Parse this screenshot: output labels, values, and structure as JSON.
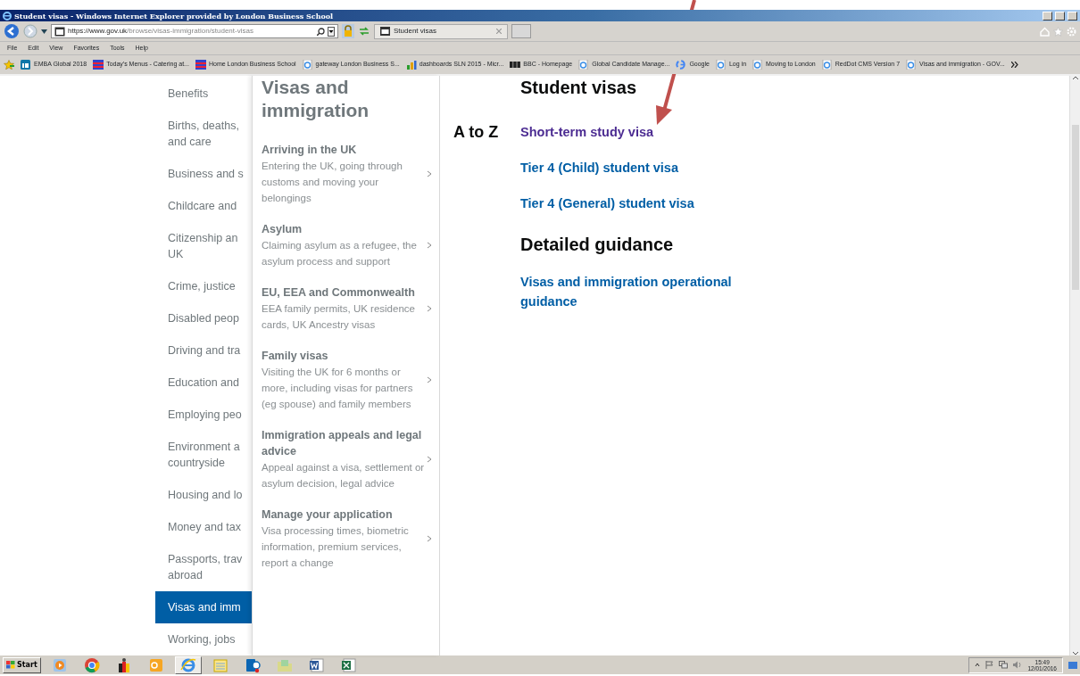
{
  "window": {
    "title": "Student visas - Windows Internet Explorer provided by London Business School"
  },
  "address_bar": {
    "url_host": "https://www.gov.uk",
    "url_path": "/browse/visas-immigration/student-visas"
  },
  "tabs": [
    {
      "label": "Student visas",
      "selected": true
    }
  ],
  "menu": [
    "File",
    "Edit",
    "View",
    "Favorites",
    "Tools",
    "Help"
  ],
  "favorites": [
    {
      "label": "EMBA Global 2018",
      "kind": "linkedin"
    },
    {
      "label": "Today's Menus - Catering at...",
      "kind": "list"
    },
    {
      "label": "Home  London Business School",
      "kind": "list"
    },
    {
      "label": "gateway London Business S...",
      "kind": "ie"
    },
    {
      "label": "dashboards SLN 2015 - Micr...",
      "kind": "chart"
    },
    {
      "label": "BBC - Homepage",
      "kind": "bbc"
    },
    {
      "label": "Global Candidate Manage...",
      "kind": "ie"
    },
    {
      "label": "Google",
      "kind": "google"
    },
    {
      "label": "Log in",
      "kind": "ie"
    },
    {
      "label": "Moving to London",
      "kind": "ie"
    },
    {
      "label": "RedDot CMS Version 7",
      "kind": "ie"
    },
    {
      "label": "Visas and immigration - GOV...",
      "kind": "ie"
    }
  ],
  "sidebar": {
    "items": [
      {
        "lines": [
          "Benefits"
        ],
        "selected": false
      },
      {
        "lines": [
          "Births, deaths,",
          "and care"
        ],
        "selected": false
      },
      {
        "lines": [
          "Business and s"
        ],
        "selected": false
      },
      {
        "lines": [
          "Childcare and"
        ],
        "selected": false
      },
      {
        "lines": [
          "Citizenship an",
          "UK"
        ],
        "selected": false
      },
      {
        "lines": [
          "Crime, justice"
        ],
        "selected": false
      },
      {
        "lines": [
          "Disabled peop"
        ],
        "selected": false
      },
      {
        "lines": [
          "Driving and tra"
        ],
        "selected": false
      },
      {
        "lines": [
          "Education and"
        ],
        "selected": false
      },
      {
        "lines": [
          "Employing peo"
        ],
        "selected": false
      },
      {
        "lines": [
          "Environment a",
          "countryside"
        ],
        "selected": false
      },
      {
        "lines": [
          "Housing and lo"
        ],
        "selected": false
      },
      {
        "lines": [
          "Money and tax"
        ],
        "selected": false
      },
      {
        "lines": [
          "Passports, trav",
          "abroad"
        ],
        "selected": false
      },
      {
        "lines": [
          "Visas and imm"
        ],
        "selected": true
      },
      {
        "lines": [
          "Working, jobs"
        ],
        "selected": false
      }
    ]
  },
  "section": {
    "title": "Visas and immigration",
    "items": [
      {
        "title": "Arriving in the UK",
        "description": "Entering the UK, going through customs and moving your belongings"
      },
      {
        "title": "Asylum",
        "description": "Claiming asylum as a refugee, the asylum process and support"
      },
      {
        "title": "EU, EEA and Commonwealth",
        "description": "EEA family permits, UK residence cards, UK Ancestry visas"
      },
      {
        "title": "Family visas",
        "description": "Visiting the UK for 6 months or more, including visas for partners (eg spouse) and family members"
      },
      {
        "title": "Immigration appeals and legal advice",
        "description": "Appeal against a visa, settlement or asylum decision, legal advice"
      },
      {
        "title": "Manage your application",
        "description": "Visa processing times, biometric information, premium services, report a change"
      }
    ]
  },
  "content": {
    "heading": "Student visas",
    "index_label": "A to Z",
    "links": [
      {
        "label": "Short-term study visa",
        "visited": true
      },
      {
        "label": "Tier 4 (Child) student visa",
        "visited": false
      },
      {
        "label": "Tier 4 (General) student visa",
        "visited": false
      }
    ],
    "guidance_heading": "Detailed guidance",
    "guidance_links": [
      {
        "label": "Visas and immigration operational guidance",
        "visited": false
      }
    ]
  },
  "taskbar": {
    "start": "Start",
    "apps": [
      {
        "kind": "media",
        "selected": false
      },
      {
        "kind": "chrome",
        "selected": false
      },
      {
        "kind": "gift",
        "selected": false
      },
      {
        "kind": "outlook",
        "selected": false
      },
      {
        "kind": "ie",
        "selected": true
      },
      {
        "kind": "notes",
        "selected": false
      },
      {
        "kind": "lync",
        "selected": false
      },
      {
        "kind": "folder",
        "selected": false
      },
      {
        "kind": "word",
        "selected": false
      },
      {
        "kind": "excel",
        "selected": false
      }
    ],
    "clock": {
      "time": "15:49",
      "date": "12/01/2016"
    }
  }
}
